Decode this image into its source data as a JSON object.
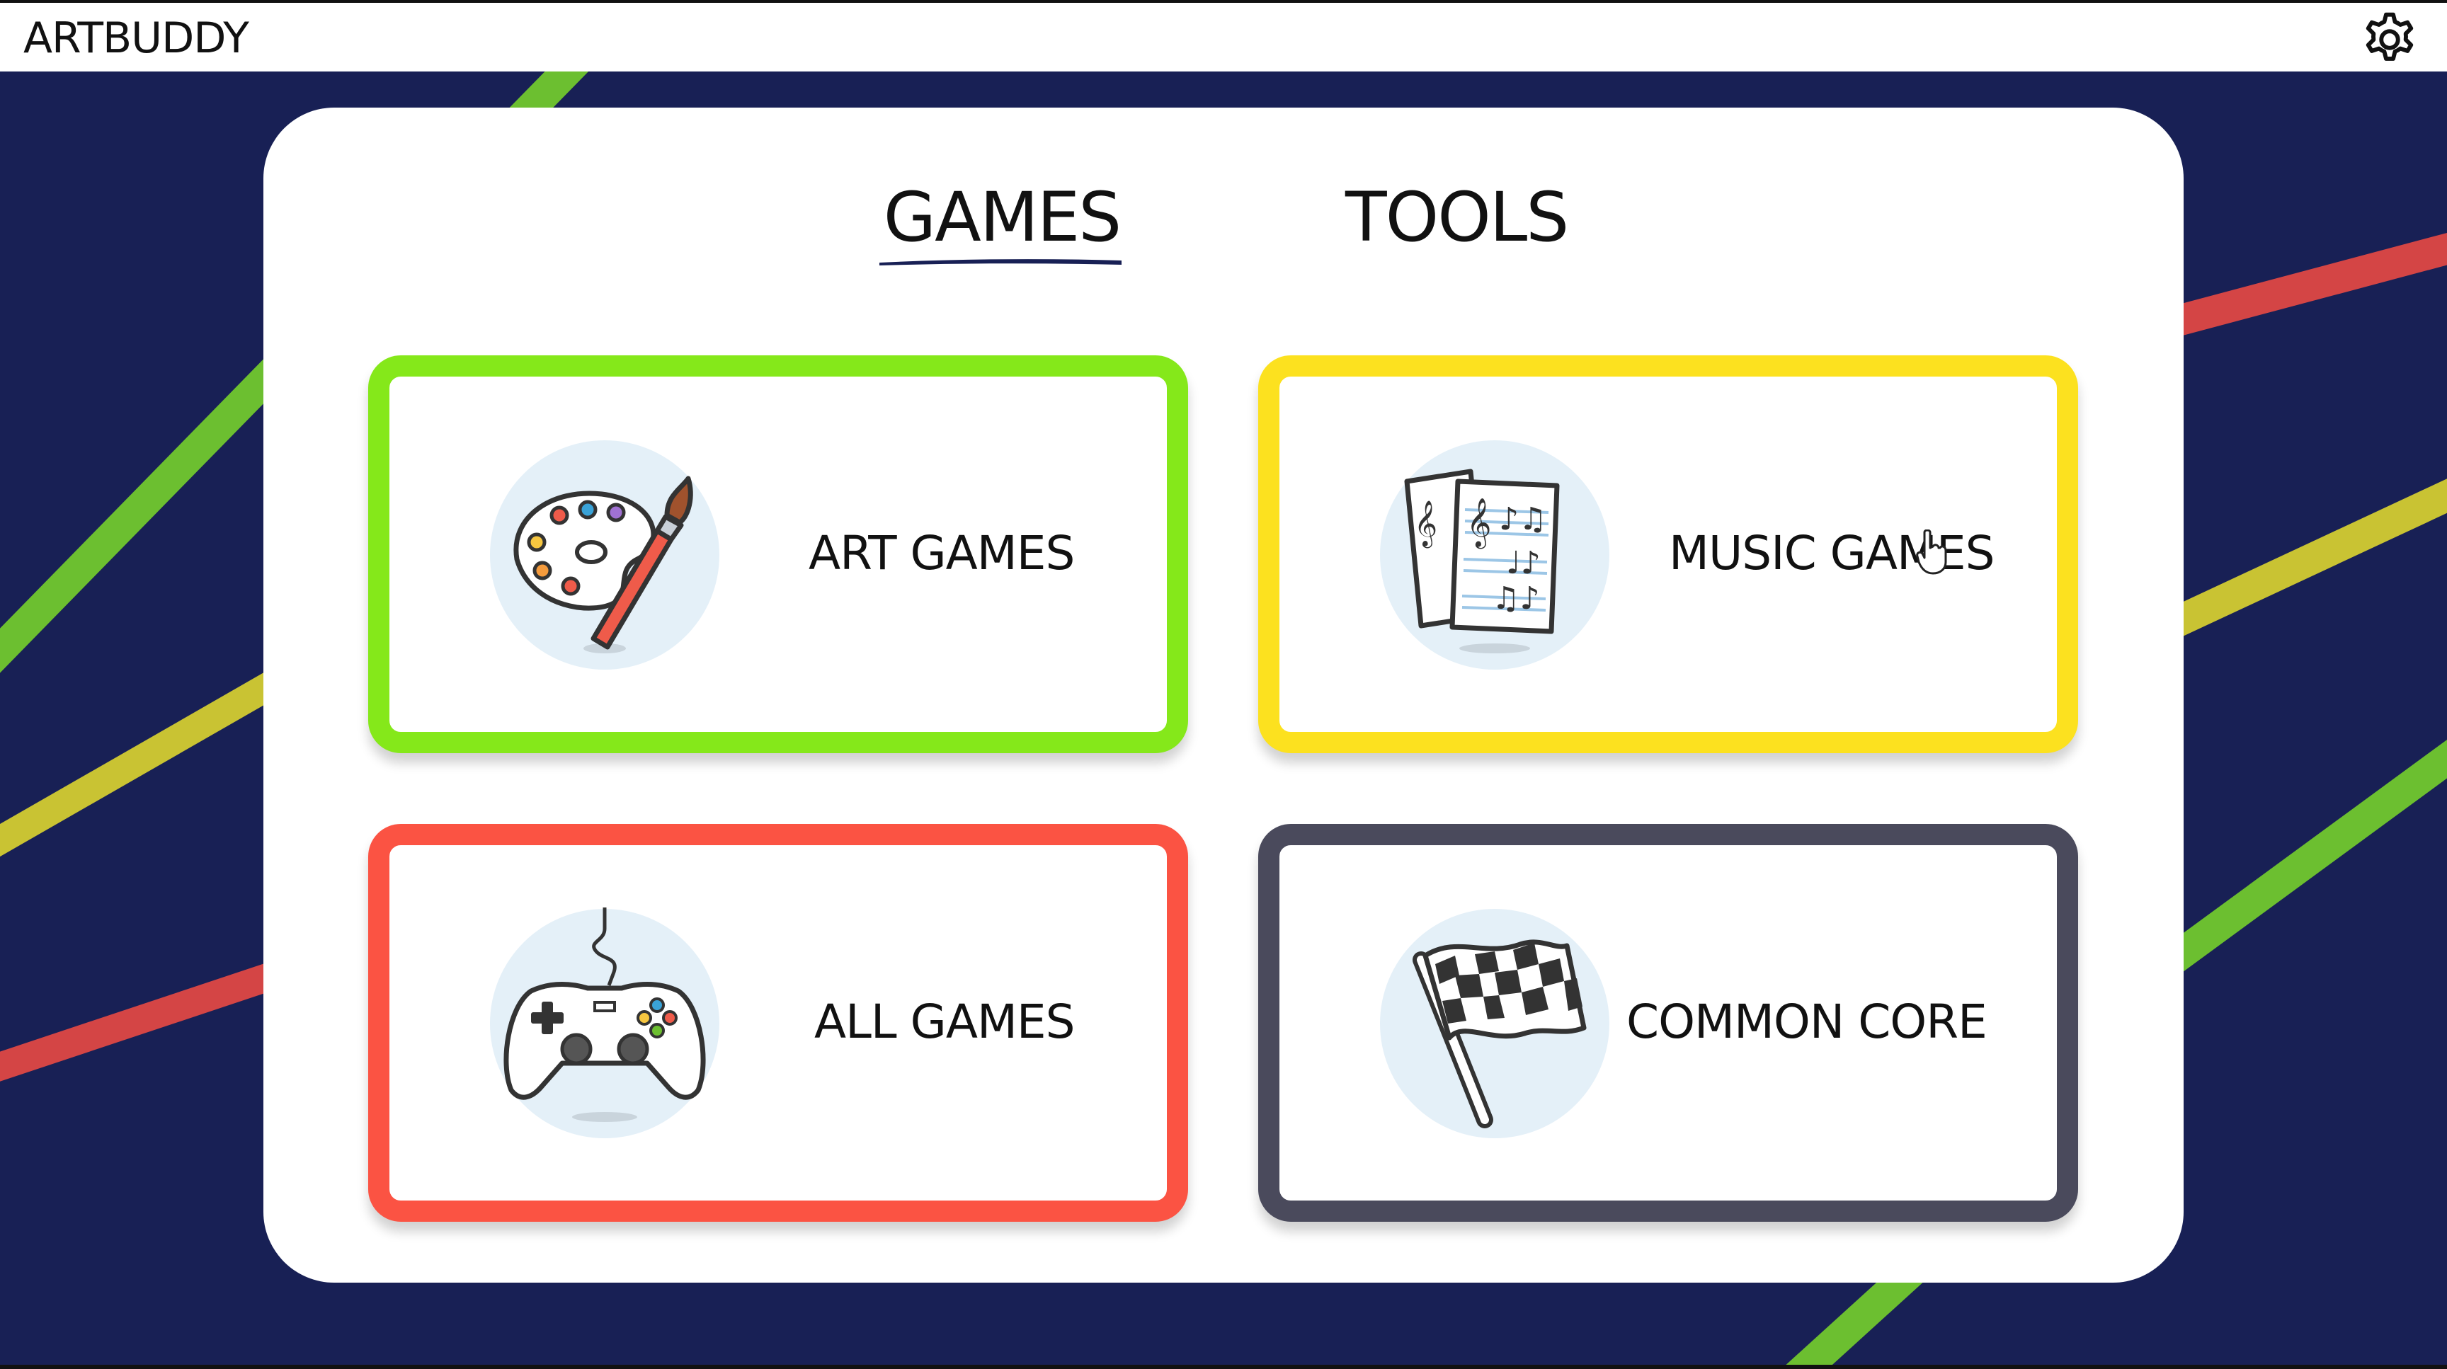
{
  "app": {
    "title": "ARTBUDDY",
    "settings_icon": "gear-icon"
  },
  "tabs": [
    {
      "label": "GAMES",
      "active": true
    },
    {
      "label": "TOOLS",
      "active": false
    }
  ],
  "cards": [
    {
      "label": "ART GAMES",
      "icon": "paint-palette-icon",
      "border_color": "#85e81a"
    },
    {
      "label": "MUSIC GAMES",
      "icon": "sheet-music-icon",
      "border_color": "#fce11f"
    },
    {
      "label": "ALL GAMES",
      "icon": "game-controller-icon",
      "border_color": "#fb5343"
    },
    {
      "label": "COMMON CORE",
      "icon": "checkered-flag-icon",
      "border_color": "#4a4a5c"
    }
  ],
  "colors": {
    "background": "#182055",
    "stripe_green": "#6cbf30",
    "stripe_yellow": "#c9c333",
    "stripe_red": "#d44545",
    "tab_underline": "#182055"
  }
}
